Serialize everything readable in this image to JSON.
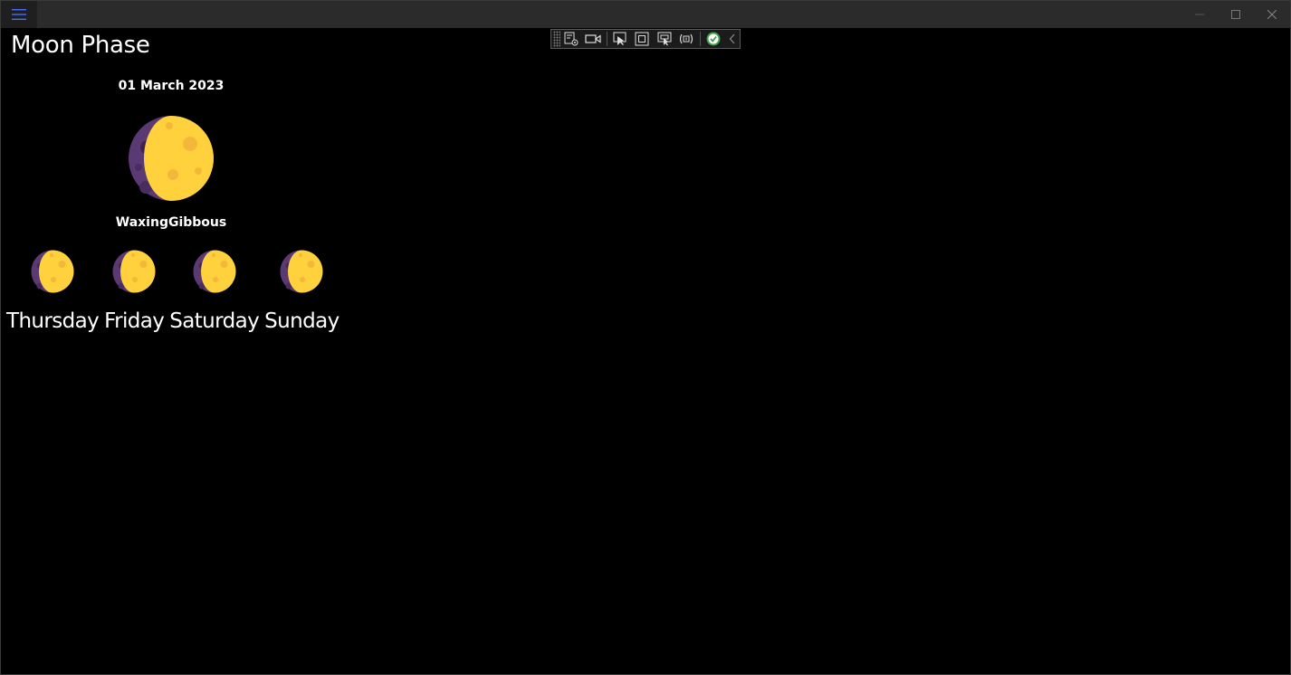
{
  "window": {
    "controls": [
      "minimize",
      "maximize",
      "close"
    ]
  },
  "debug_toolbar": {
    "buttons": [
      "live-visual-tree-icon",
      "record-icon",
      "select-element-icon",
      "display-layout-adorners-icon",
      "track-focus-icon",
      "binding-failures-icon",
      "hot-reload-status-icon",
      "collapse-icon"
    ]
  },
  "page": {
    "title": "Moon Phase",
    "date": "01 March 2023",
    "phase": "WaxingGibbous"
  },
  "forecast": [
    {
      "day": "Thursday"
    },
    {
      "day": "Friday"
    },
    {
      "day": "Saturday"
    },
    {
      "day": "Sunday"
    }
  ],
  "colors": {
    "moon_yellow": "#FFD23D",
    "moon_crater": "#F4B73A",
    "moon_dark": "#5B3A74",
    "moon_dark_crater": "#3E2352",
    "background": "#000000",
    "titlebar": "#2B2B2B",
    "hamburger_icon": "#4A6CFF"
  }
}
